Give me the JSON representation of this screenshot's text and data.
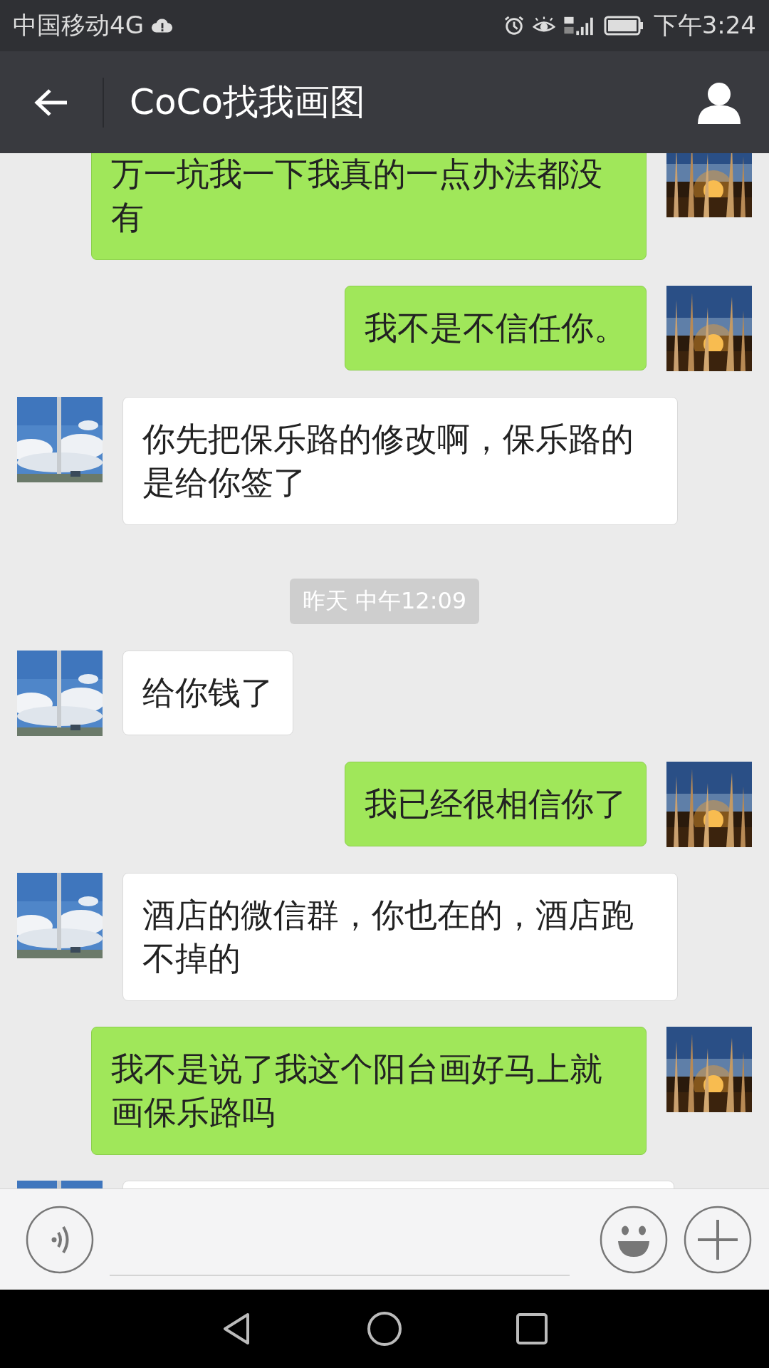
{
  "status_bar": {
    "carrier": "中国移动4G",
    "time": "下午3:24"
  },
  "header": {
    "title": "CoCo找我画图"
  },
  "messages": [
    {
      "kind": "sent",
      "text": "万一坑我一下我真的一点办法都没有"
    },
    {
      "kind": "sent",
      "text": "我不是不信任你。"
    },
    {
      "kind": "received",
      "text": "你先把保乐路的修改啊，保乐路的是给你签了"
    },
    {
      "kind": "time",
      "text": "昨天 中午12:09"
    },
    {
      "kind": "received",
      "text": "给你钱了"
    },
    {
      "kind": "sent",
      "text": "我已经很相信你了"
    },
    {
      "kind": "received",
      "text": "酒店的微信群，你也在的，酒店跑不掉的"
    },
    {
      "kind": "sent",
      "text": "我不是说了我这个阳台画好马上就画保乐路吗"
    },
    {
      "kind": "received_partial"
    }
  ]
}
